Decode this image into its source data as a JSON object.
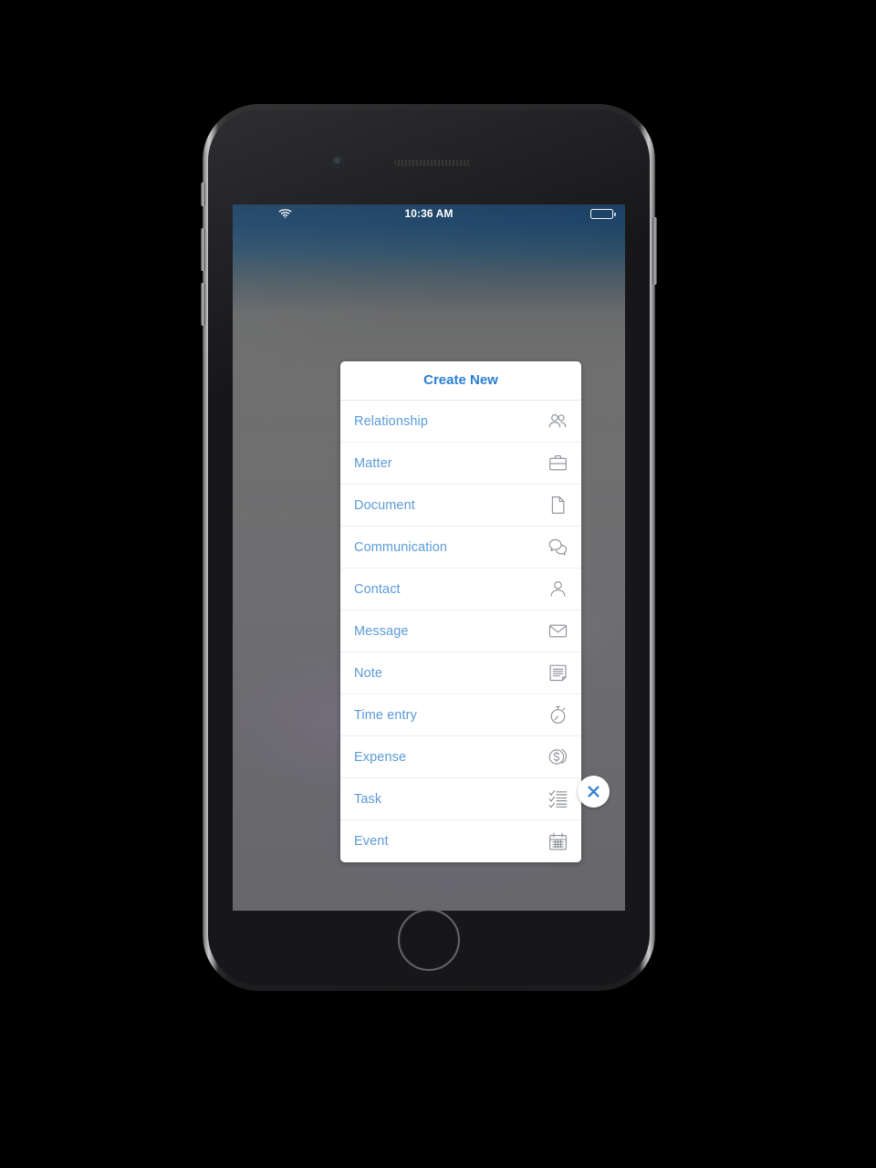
{
  "device": {
    "name": "iphone-frame",
    "home_button": "home-button",
    "camera": "front-camera",
    "speaker": "earpiece-speaker"
  },
  "status_bar": {
    "wifi_icon": "wifi-icon",
    "time": "10:36 AM",
    "battery_icon": "battery-icon"
  },
  "dialog": {
    "title": "Create New",
    "items": [
      {
        "label": "Relationship",
        "icon": "two-people-icon"
      },
      {
        "label": "Matter",
        "icon": "briefcase-icon"
      },
      {
        "label": "Document",
        "icon": "document-page-icon"
      },
      {
        "label": "Communication",
        "icon": "speech-bubbles-icon"
      },
      {
        "label": "Contact",
        "icon": "person-icon"
      },
      {
        "label": "Message",
        "icon": "inbox-tray-icon"
      },
      {
        "label": "Note",
        "icon": "lined-note-icon"
      },
      {
        "label": "Time entry",
        "icon": "stopwatch-icon"
      },
      {
        "label": "Expense",
        "icon": "dollar-coin-icon"
      },
      {
        "label": "Task",
        "icon": "checklist-icon"
      },
      {
        "label": "Event",
        "icon": "calendar-icon"
      }
    ]
  },
  "close_button": {
    "icon": "close-x-icon",
    "label": "Close"
  },
  "colors": {
    "accent_blue": "#5b9bd8",
    "title_blue": "#2a7ed0",
    "icon_gray": "#8a8e93",
    "dialog_bg": "#ffffff",
    "status_bar_bg": "#173d60"
  }
}
